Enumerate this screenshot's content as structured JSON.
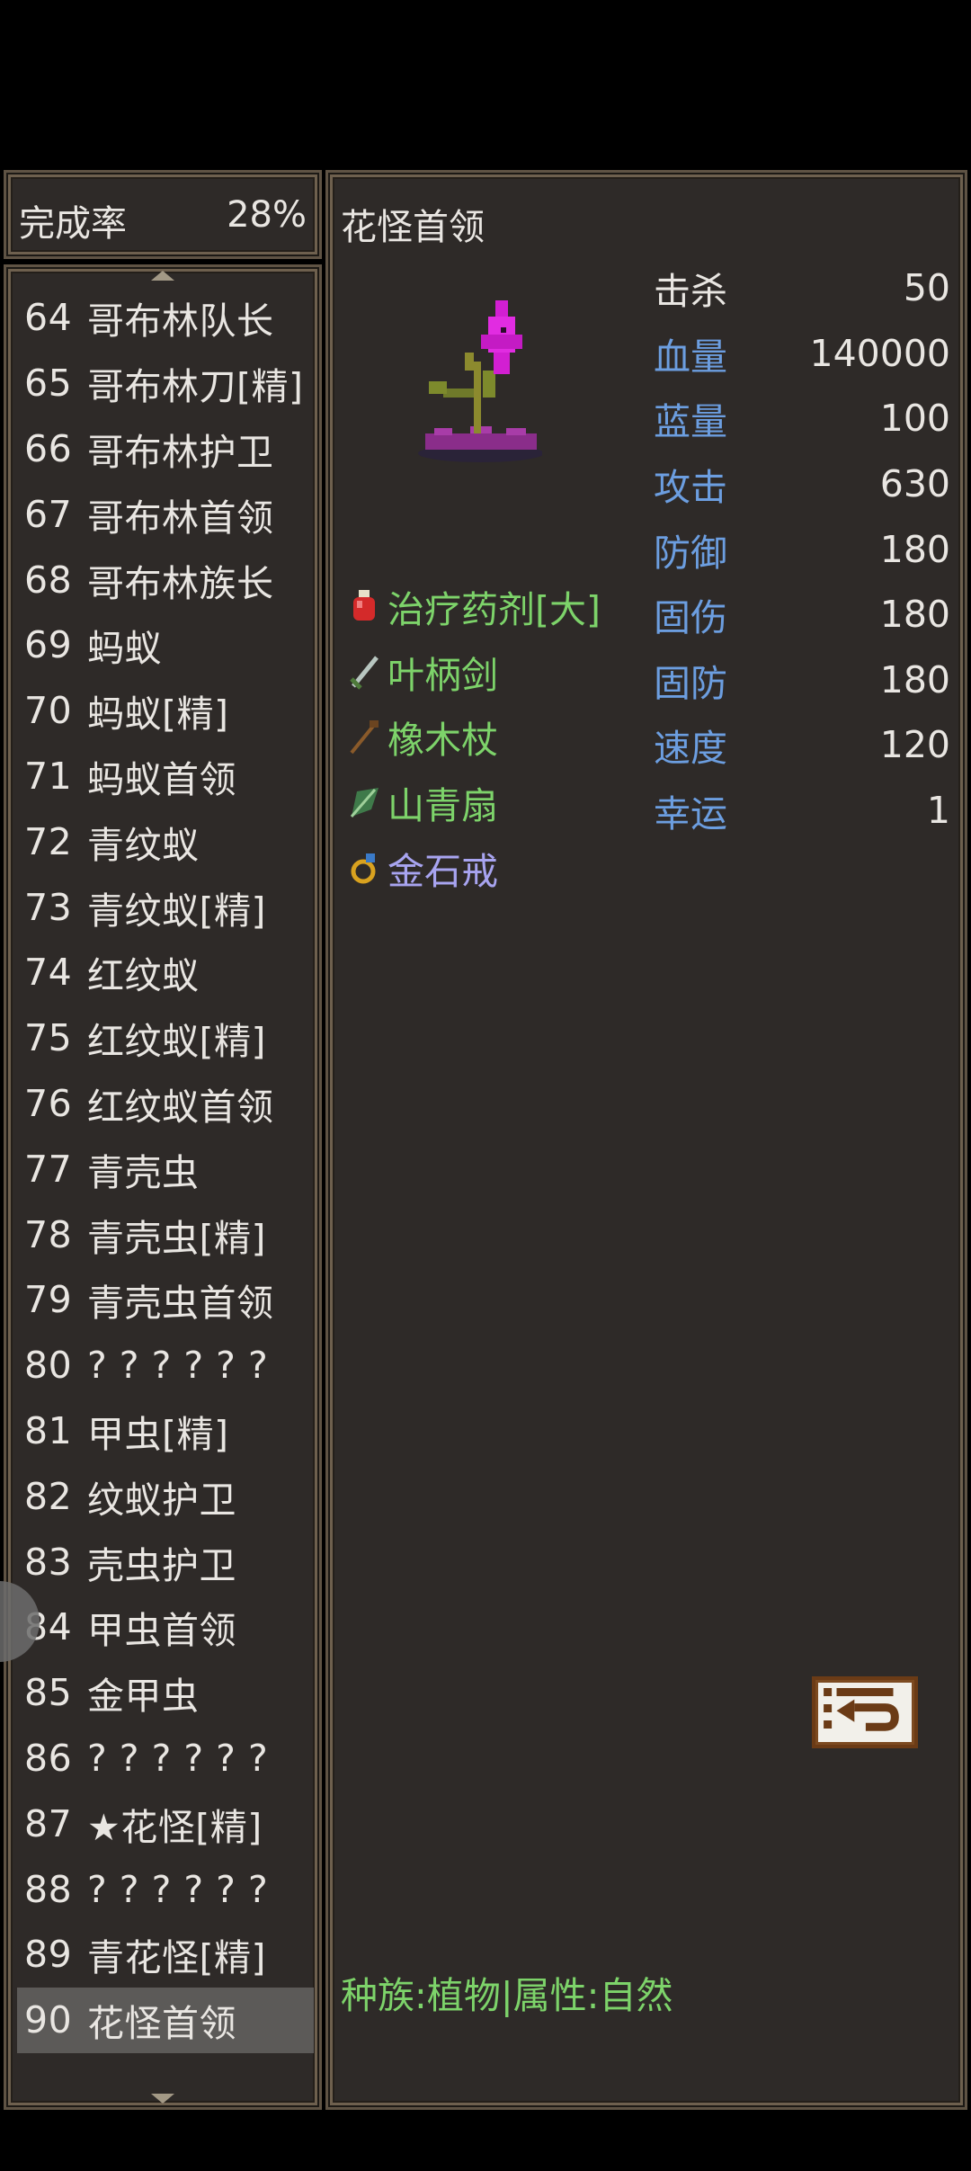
{
  "completion": {
    "label": "完成率",
    "value": "28%"
  },
  "monster_list": [
    {
      "num": "64",
      "name": "哥布林队长"
    },
    {
      "num": "65",
      "name": "哥布林刀[精]"
    },
    {
      "num": "66",
      "name": "哥布林护卫"
    },
    {
      "num": "67",
      "name": "哥布林首领"
    },
    {
      "num": "68",
      "name": "哥布林族长"
    },
    {
      "num": "69",
      "name": "蚂蚁"
    },
    {
      "num": "70",
      "name": "蚂蚁[精]"
    },
    {
      "num": "71",
      "name": "蚂蚁首领"
    },
    {
      "num": "72",
      "name": "青纹蚁"
    },
    {
      "num": "73",
      "name": "青纹蚁[精]"
    },
    {
      "num": "74",
      "name": "红纹蚁"
    },
    {
      "num": "75",
      "name": "红纹蚁[精]"
    },
    {
      "num": "76",
      "name": "红纹蚁首领"
    },
    {
      "num": "77",
      "name": "青壳虫"
    },
    {
      "num": "78",
      "name": "青壳虫[精]"
    },
    {
      "num": "79",
      "name": "青壳虫首领"
    },
    {
      "num": "80",
      "name": "? ? ? ? ? ?"
    },
    {
      "num": "81",
      "name": "甲虫[精]"
    },
    {
      "num": "82",
      "name": "纹蚁护卫"
    },
    {
      "num": "83",
      "name": "壳虫护卫"
    },
    {
      "num": "84",
      "name": "甲虫首领"
    },
    {
      "num": "85",
      "name": "金甲虫"
    },
    {
      "num": "86",
      "name": "? ? ? ? ? ?"
    },
    {
      "num": "87",
      "name": "★花怪[精]"
    },
    {
      "num": "88",
      "name": "? ? ? ? ? ?"
    },
    {
      "num": "89",
      "name": "青花怪[精]"
    },
    {
      "num": "90",
      "name": "花怪首领"
    }
  ],
  "selected_index": 26,
  "detail": {
    "title": "花怪首领",
    "stats": [
      {
        "label": "击杀",
        "value": "50"
      },
      {
        "label": "血量",
        "value": "140000"
      },
      {
        "label": "蓝量",
        "value": "100"
      },
      {
        "label": "攻击",
        "value": "630"
      },
      {
        "label": "防御",
        "value": "180"
      },
      {
        "label": "固伤",
        "value": "180"
      },
      {
        "label": "固防",
        "value": "180"
      },
      {
        "label": "速度",
        "value": "120"
      },
      {
        "label": "幸运",
        "value": "1"
      }
    ],
    "drops": [
      {
        "name": "治疗药剂[大]",
        "icon": "potion-icon"
      },
      {
        "name": "叶柄剑",
        "icon": "sword-icon"
      },
      {
        "name": "橡木杖",
        "icon": "staff-icon"
      },
      {
        "name": "山青扇",
        "icon": "fan-icon"
      },
      {
        "name": "金石戒",
        "icon": "ring-icon"
      }
    ],
    "species_line": "种族:植物|属性:自然"
  },
  "colors": {
    "text_blue": "#6c9ee0",
    "text_green": "#7dd36a",
    "text_violet": "#a8a4f0",
    "panel_bg": "#2e2a28"
  }
}
